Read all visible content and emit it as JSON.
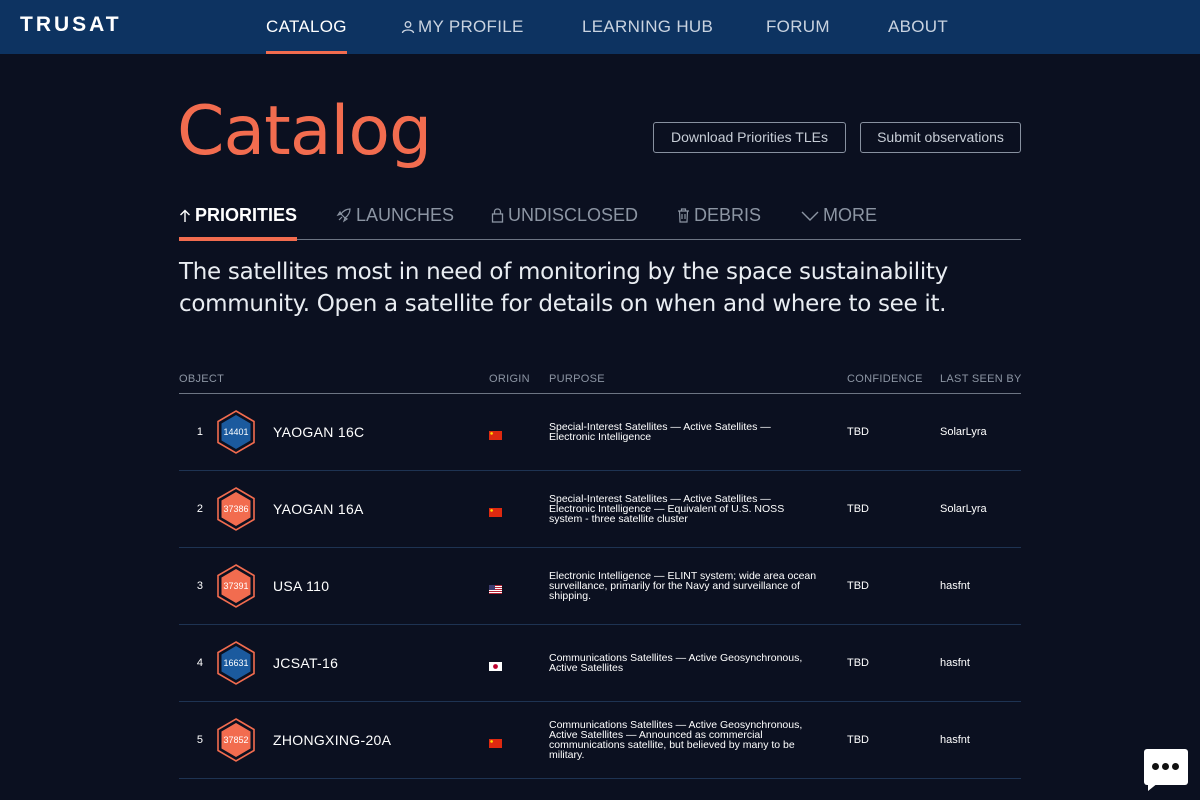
{
  "nav": {
    "logo": "TRUSAT",
    "items": [
      {
        "label": "CATALOG"
      },
      {
        "label": "MY PROFILE"
      },
      {
        "label": "LEARNING HUB"
      },
      {
        "label": "FORUM"
      },
      {
        "label": "ABOUT"
      }
    ]
  },
  "header": {
    "title": "Catalog",
    "download_label": "Download Priorities TLEs",
    "submit_label": "Submit observations"
  },
  "tabs": [
    {
      "label": "PRIORITIES",
      "icon": "arrow-up-icon"
    },
    {
      "label": "LAUNCHES",
      "icon": "rocket-icon"
    },
    {
      "label": "UNDISCLOSED",
      "icon": "lock-icon"
    },
    {
      "label": "DEBRIS",
      "icon": "trash-icon"
    },
    {
      "label": "MORE",
      "icon": "chevron-down-icon"
    }
  ],
  "description": "The satellites most in need of monitoring by the space sustainability community. Open a satellite for details on when and where to see it.",
  "table": {
    "headers": {
      "object": "OBJECT",
      "origin": "ORIGIN",
      "purpose": "PURPOSE",
      "confidence": "CONFIDENCE",
      "last_seen": "LAST SEEN BY"
    },
    "rows": [
      {
        "rank": "1",
        "norad": "14401",
        "name": "YAOGAN 16C",
        "origin": "china-flag",
        "purpose": "Special-Interest Satellites — Active Satellites — Electronic Intelligence",
        "confidence": "TBD",
        "last_seen": "SolarLyra",
        "badge_color": "#1b5a9e"
      },
      {
        "rank": "2",
        "norad": "37386",
        "name": "YAOGAN 16A",
        "origin": "china-flag",
        "purpose": "Special-Interest Satellites — Active Satellites — Electronic Intelligence — Equivalent of U.S. NOSS system - three satellite cluster",
        "confidence": "TBD",
        "last_seen": "SolarLyra",
        "badge_color": "#f26c4f"
      },
      {
        "rank": "3",
        "norad": "37391",
        "name": "USA 110",
        "origin": "usa-flag",
        "purpose": "Electronic Intelligence — ELINT system; wide area ocean surveillance, primarily for the Navy and surveillance of shipping.",
        "confidence": "TBD",
        "last_seen": "hasfnt",
        "badge_color": "#f26c4f"
      },
      {
        "rank": "4",
        "norad": "16631",
        "name": "JCSAT-16",
        "origin": "japan-flag",
        "purpose": "Communications Satellites — Active Geosynchronous, Active Satellites",
        "confidence": "TBD",
        "last_seen": "hasfnt",
        "badge_color": "#1b5a9e"
      },
      {
        "rank": "5",
        "norad": "37852",
        "name": "ZHONGXING-20A",
        "origin": "china-flag",
        "purpose": "Communications Satellites — Active Geosynchronous, Active Satellites — Announced as commercial communications satellite, but believed by many to be military.",
        "confidence": "TBD",
        "last_seen": "hasfnt",
        "badge_color": "#f26c4f"
      }
    ]
  },
  "colors": {
    "accent": "#f26c4f",
    "nav_bg": "#0d3361",
    "page_bg": "#0b1020",
    "badge_blue": "#1b5a9e"
  },
  "chat_icon": "chat-bubble-icon"
}
